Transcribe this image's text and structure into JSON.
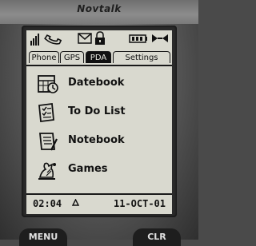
{
  "device": {
    "brand": "Novtalk"
  },
  "tabs": [
    {
      "label": "Phone",
      "active": false
    },
    {
      "label": "GPS",
      "active": false
    },
    {
      "label": "PDA",
      "active": true
    },
    {
      "label": "Settings",
      "active": false
    }
  ],
  "menu": {
    "items": [
      {
        "label": "Datebook",
        "icon": "datebook-icon"
      },
      {
        "label": "To Do List",
        "icon": "todo-list-icon"
      },
      {
        "label": "Notebook",
        "icon": "notebook-icon"
      },
      {
        "label": "Games",
        "icon": "games-icon"
      }
    ]
  },
  "status": {
    "time": "02:04",
    "date": "11-OCT-01",
    "icons": [
      "signal-strength-icon",
      "phone-handset-icon",
      "envelope-icon",
      "lock-icon",
      "battery-icon",
      "ring-volume-icon"
    ]
  },
  "softkeys": {
    "left": "MENU",
    "right": "CLR"
  }
}
